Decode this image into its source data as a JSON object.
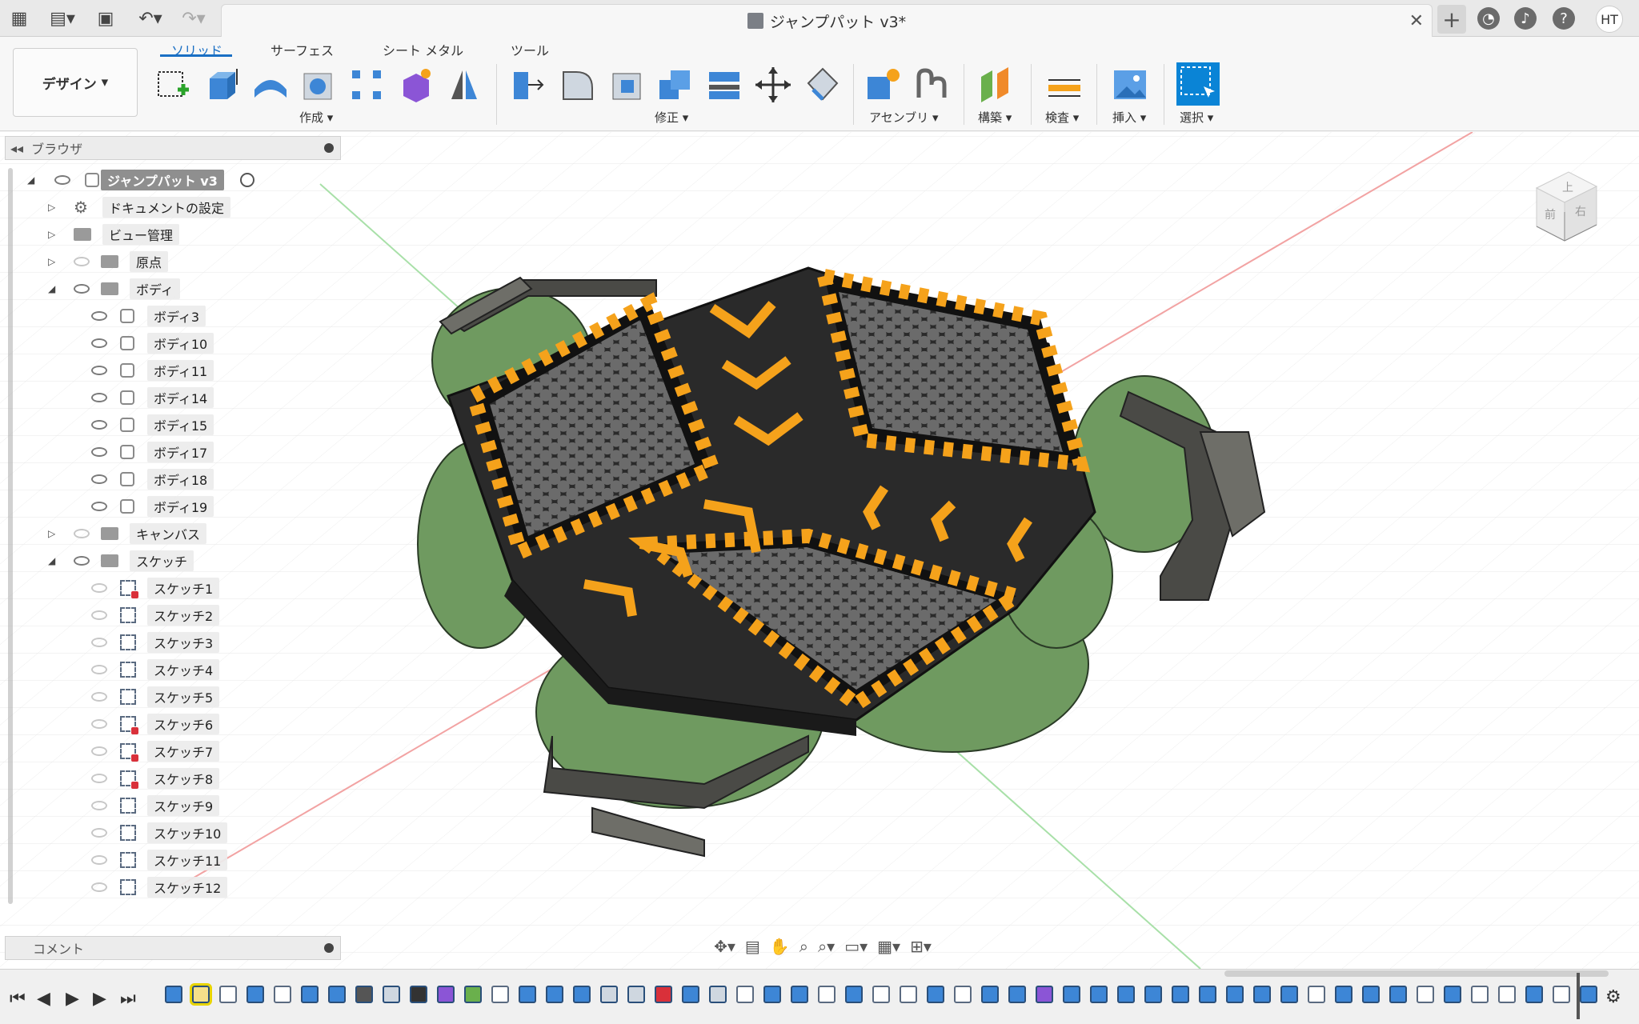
{
  "window": {
    "title": "ジャンプパット v3*"
  },
  "toolbar": {
    "workspace": "デザイン",
    "tabs": [
      "ソリッド",
      "サーフェス",
      "シート メタル",
      "ツール"
    ],
    "groups": [
      "作成",
      "修正",
      "アセンブリ",
      "構築",
      "検査",
      "挿入",
      "選択"
    ]
  },
  "user": {
    "initials": "HT"
  },
  "browser": {
    "title": "ブラウザ",
    "root": "ジャンプパット v3",
    "folders": {
      "settings": "ドキュメントの設定",
      "views": "ビュー管理",
      "origin": "原点",
      "bodies": "ボディ",
      "canvas": "キャンバス",
      "sketches": "スケッチ"
    },
    "bodies": [
      "ボディ3",
      "ボディ10",
      "ボディ11",
      "ボディ14",
      "ボディ15",
      "ボディ17",
      "ボディ18",
      "ボディ19"
    ],
    "sketches": [
      "スケッチ1",
      "スケッチ2",
      "スケッチ3",
      "スケッチ4",
      "スケッチ5",
      "スケッチ6",
      "スケッチ7",
      "スケッチ8",
      "スケッチ9",
      "スケッチ10",
      "スケッチ11",
      "スケッチ12"
    ]
  },
  "comments": {
    "title": "コメント"
  },
  "viewcube": {
    "top": "上",
    "front": "前",
    "right": "右"
  },
  "colors": {
    "accent": "#1a6fc4",
    "pad": "#2a2a2a",
    "hazard": "#f5a21b",
    "bumper": "#6f9a60",
    "frame": "#4a4a46"
  }
}
